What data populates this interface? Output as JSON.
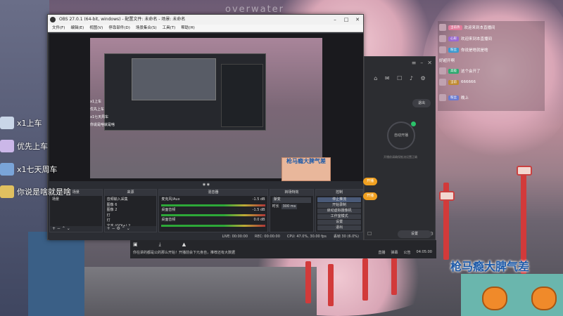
{
  "watermark": "overwater",
  "obs": {
    "title": "OBS 27.0.1 (64-bit, windows) - 配置文件: 未命名 - 场景: 未命名",
    "menu": [
      "文件(F)",
      "编辑(E)",
      "视图(V)",
      "停靠部件(D)",
      "场景集合(S)",
      "工具(T)",
      "帮助(H)"
    ],
    "preview_list": [
      "x1上车",
      "优先上车",
      "x1七天周车",
      "你说是啥就是啥"
    ],
    "preview_sign": "枪马瘾大脾气差",
    "docks": {
      "scenes": {
        "title": "场景",
        "items": [
          "场景"
        ]
      },
      "sources": {
        "title": "来源",
        "items": [
          "音频输入采集",
          "图像 6",
          "图像 2",
          "灯",
          "灯",
          "文本 (GDI+) 2"
        ]
      },
      "mixer": {
        "title": "混音器",
        "items": [
          "麦克风/Aux",
          "桌面音频",
          "桌面音频"
        ],
        "levels": [
          "-1.5 dB",
          "-1.5 dB",
          "0.0 dB"
        ]
      },
      "transitions": {
        "title": "转场特效",
        "type": "渐变",
        "duration_label": "时长",
        "duration": "300 ms"
      },
      "controls": {
        "title": "控制",
        "buttons": [
          "停止推流",
          "开始录制",
          "启动虚拟摄像机",
          "工作室模式",
          "设置",
          "退出"
        ]
      }
    },
    "status": {
      "live": "LIVE: 00:00:00",
      "rec": "REC: 00:00:00",
      "cpu": "CPU: 47.0%, 30.00 fps",
      "dropped": "丢帧 30 (6.0%)"
    }
  },
  "app": {
    "exit_label": "退出",
    "ring_label": "自动开播",
    "hint": "开播前请确保推流设置正确",
    "pills": [
      "开播",
      "开播"
    ],
    "controls_label": "设置",
    "bottom_msg": "你在讲的都是公的那么开始！开播前会下元身自，推荐还有大数据",
    "bottom_right": [
      "直播",
      "弹幕",
      "公告",
      "04:05:00"
    ],
    "bottom_icons": [
      "▣",
      "⤓",
      "▲"
    ]
  },
  "chat": [
    {
      "tag": "当前热",
      "text": "欢迎来到本直播间"
    },
    {
      "tag": "心形",
      "text": "欢迎来到本直播间"
    },
    {
      "tag": "粉丝",
      "text": "你说是啥就是啥"
    },
    {
      "tag": "",
      "text": "好超开啊"
    },
    {
      "tag": "高级",
      "text": "这个会开了"
    },
    {
      "tag": "当前",
      "text": "666666"
    },
    {
      "tag": "粉丝",
      "text": "晚上"
    }
  ],
  "danmaku": [
    "x1上车",
    "优先上车",
    "x1七天周车",
    "你说是啥就是啥"
  ],
  "sign_text": "枪马瘾大脾气差",
  "colors": {
    "accent": "#f0a020",
    "live_green": "#2bc26a",
    "sign_bg": "#6ab6ad",
    "sign_text": "#1e5aa8"
  }
}
